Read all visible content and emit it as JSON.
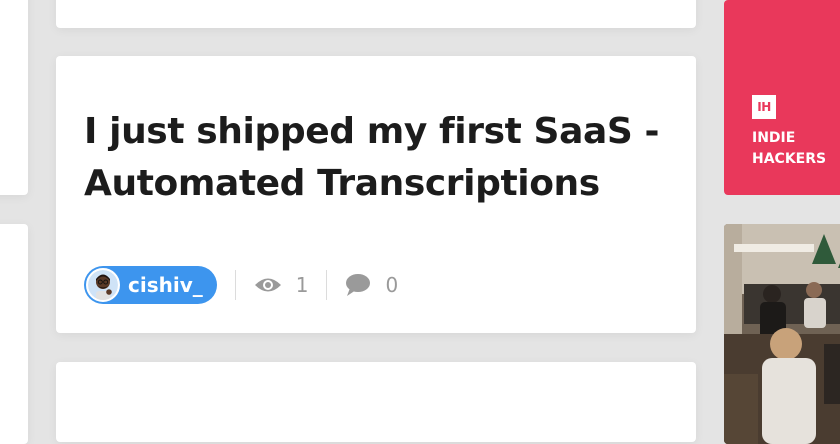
{
  "post": {
    "title": "I just shipped my first SaaS - Automated Transcriptions",
    "author": "cishiv_",
    "views": "1",
    "comments": "0"
  },
  "ih_card": {
    "logo_text": "IH",
    "label": "INDIE HACKERS"
  },
  "colors": {
    "background": "#e4e4e4",
    "author_pill": "#3d95ee",
    "ih_brand": "#e9385b",
    "meta_gray": "#9a9a9a"
  },
  "icons": {
    "views": "eye-icon",
    "comments": "speech-bubble-icon"
  }
}
